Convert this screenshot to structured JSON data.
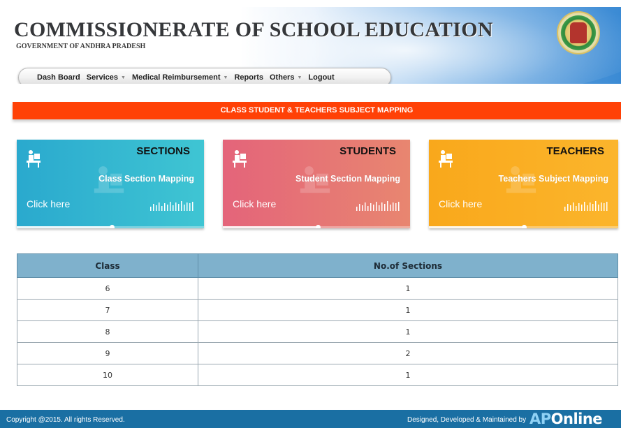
{
  "header": {
    "title": "COMMISSIONERATE OF SCHOOL EDUCATION",
    "subtitle": "GOVERNMENT OF ANDHRA PRADESH",
    "seal_icon": "state-emblem-seal"
  },
  "nav": {
    "items": [
      {
        "label": "Dash Board",
        "has_dropdown": false
      },
      {
        "label": "Services",
        "has_dropdown": true
      },
      {
        "label": "Medical Reimbursement",
        "has_dropdown": true
      },
      {
        "label": "Reports",
        "has_dropdown": false
      },
      {
        "label": "Others",
        "has_dropdown": true
      },
      {
        "label": "Logout",
        "has_dropdown": false
      }
    ]
  },
  "banner": {
    "text": "CLASS STUDENT & TEACHERS SUBJECT MAPPING",
    "color": "#ff4106"
  },
  "cards": [
    {
      "title": "SECTIONS",
      "subtitle": "Class Section Mapping",
      "link": "Click here",
      "icon": "desk-user-icon"
    },
    {
      "title": "STUDENTS",
      "subtitle": "Student Section Mapping",
      "link": "Click here",
      "icon": "desk-user-icon"
    },
    {
      "title": "TEACHERS",
      "subtitle": "Teachers Subject Mapping",
      "link": "Click here",
      "icon": "desk-user-icon"
    }
  ],
  "table": {
    "headers": [
      "Class",
      "No.of Sections"
    ],
    "rows": [
      [
        "6",
        "1"
      ],
      [
        "7",
        "1"
      ],
      [
        "8",
        "1"
      ],
      [
        "9",
        "2"
      ],
      [
        "10",
        "1"
      ]
    ]
  },
  "footer": {
    "copyright": "Copyright @2015. All rights Reserved.",
    "credit": "Designed, Developed & Maintained by",
    "logo_ap": "AP",
    "logo_online": "Online"
  }
}
